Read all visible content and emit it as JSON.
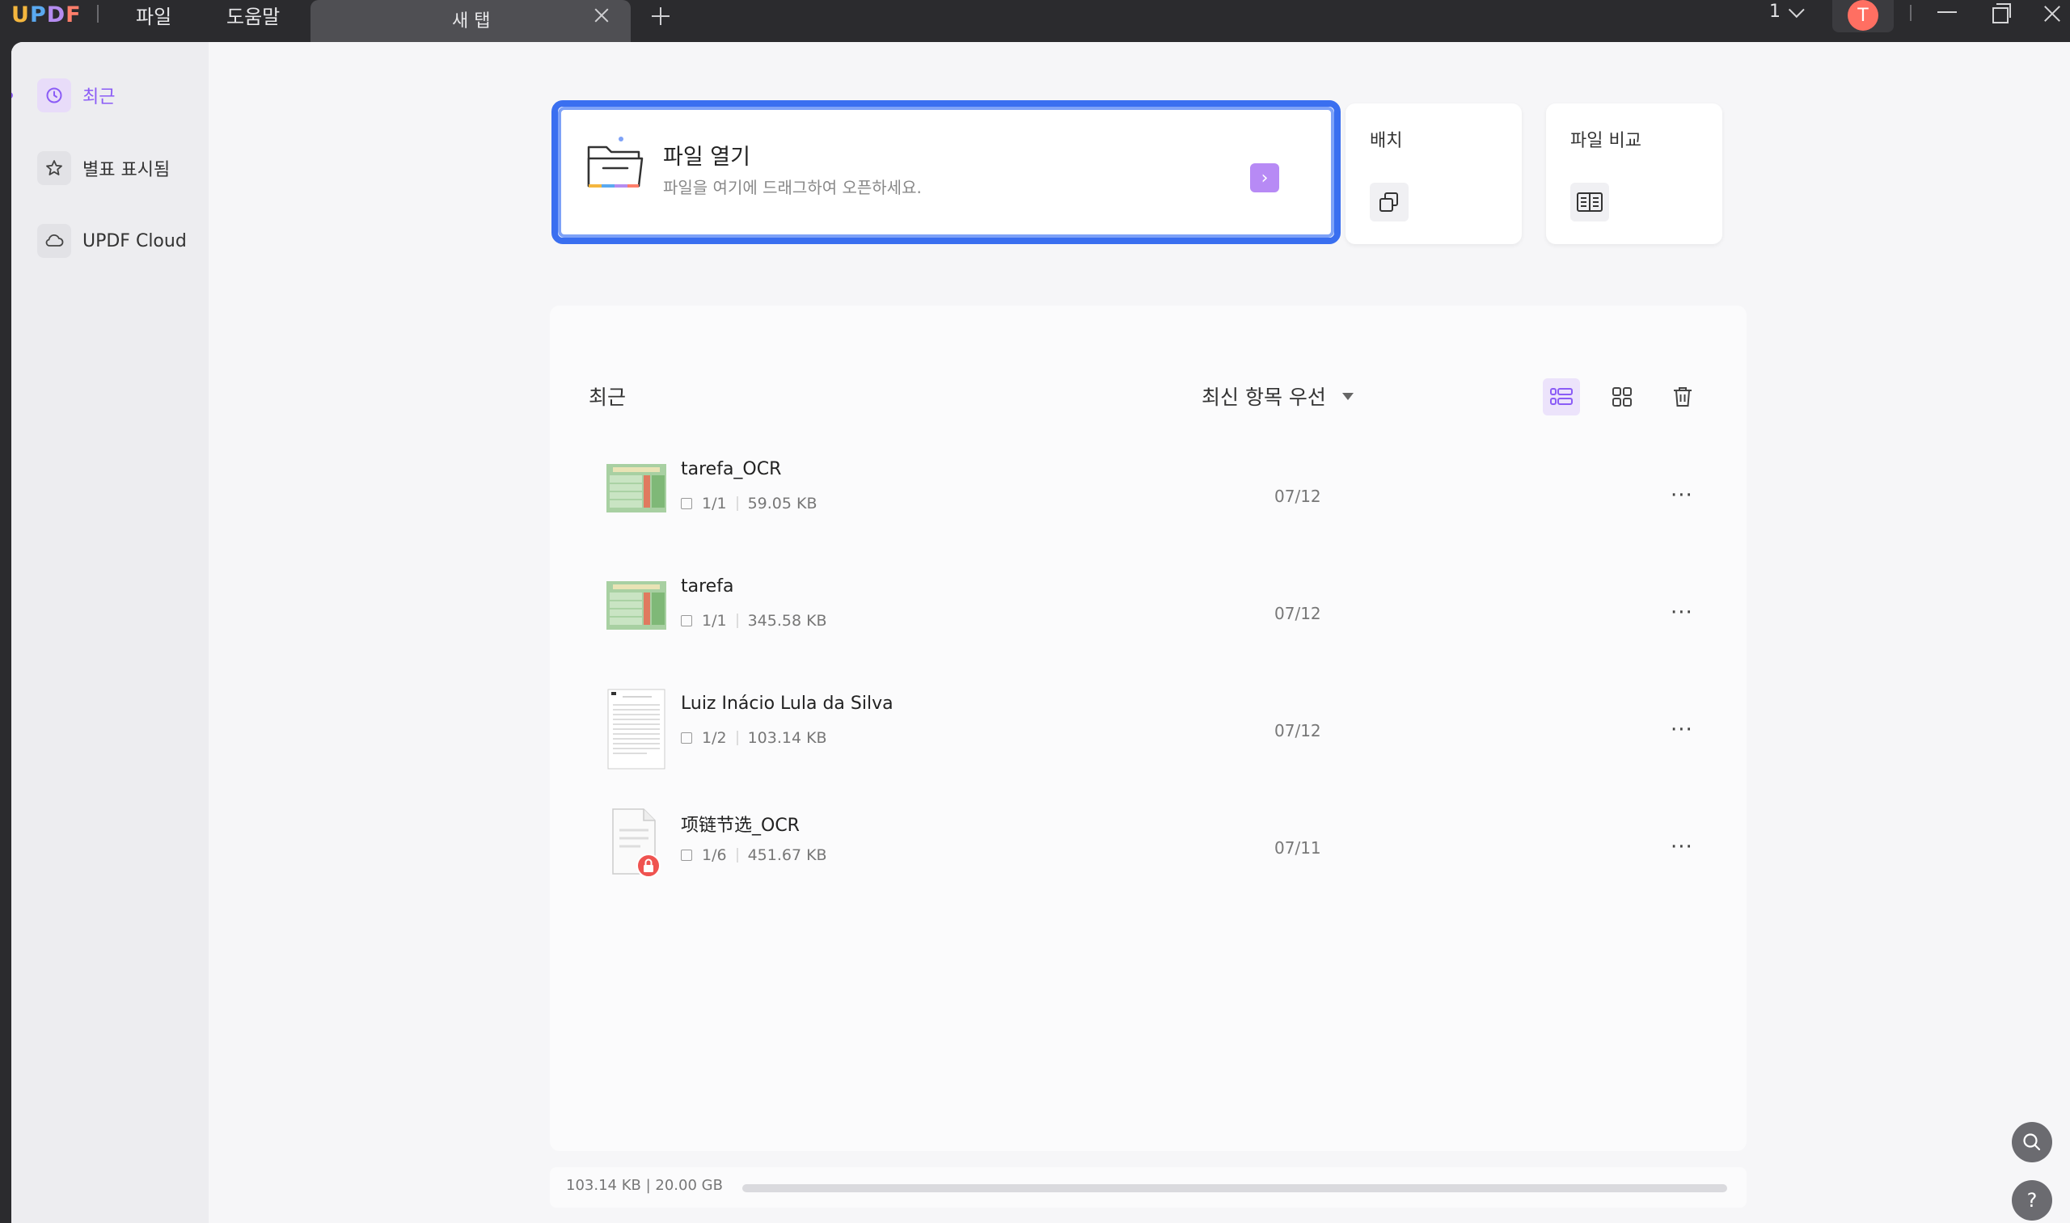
{
  "titlebar": {
    "logo": "UPDF",
    "menu": {
      "file": "파일",
      "help": "도움말"
    },
    "tab": {
      "label": "새 탭"
    },
    "page_count": "1",
    "avatar_letter": "T"
  },
  "sidebar": {
    "items": [
      {
        "label": "최근",
        "icon": "clock-icon",
        "active": true
      },
      {
        "label": "별표 표시됨",
        "icon": "star-icon",
        "active": false
      },
      {
        "label": "UPDF Cloud",
        "icon": "cloud-icon",
        "active": false
      }
    ]
  },
  "open_file": {
    "title": "파일 열기",
    "subtitle": "파일을 여기에 드래그하여 오픈하세요.",
    "go_label": "›"
  },
  "tools": {
    "batch": {
      "title": "배치",
      "icon": "batch-icon"
    },
    "compare": {
      "title": "파일 비교",
      "icon": "compare-icon"
    }
  },
  "recent": {
    "title": "최근",
    "sort_label": "최신 항목 우선",
    "files": [
      {
        "name": "tarefa_OCR",
        "pages": "1/1",
        "size": "59.05 KB",
        "date": "07/12",
        "thumb": "spreadsheet"
      },
      {
        "name": "tarefa",
        "pages": "1/1",
        "size": "345.58 KB",
        "date": "07/12",
        "thumb": "spreadsheet"
      },
      {
        "name": "Luiz Inácio Lula da Silva",
        "pages": "1/2",
        "size": "103.14 KB",
        "date": "07/12",
        "thumb": "document"
      },
      {
        "name": "项链节选_OCR",
        "pages": "1/6",
        "size": "451.67 KB",
        "date": "07/11",
        "thumb": "locked"
      }
    ],
    "more_label": "···"
  },
  "storage": {
    "text": "103.14 KB | 20.00 GB",
    "used_fraction": 5e-06
  },
  "colors": {
    "accent": "#8b5cf6",
    "open_border": "#3a6ff0",
    "titlebar": "#2b2b2e"
  }
}
